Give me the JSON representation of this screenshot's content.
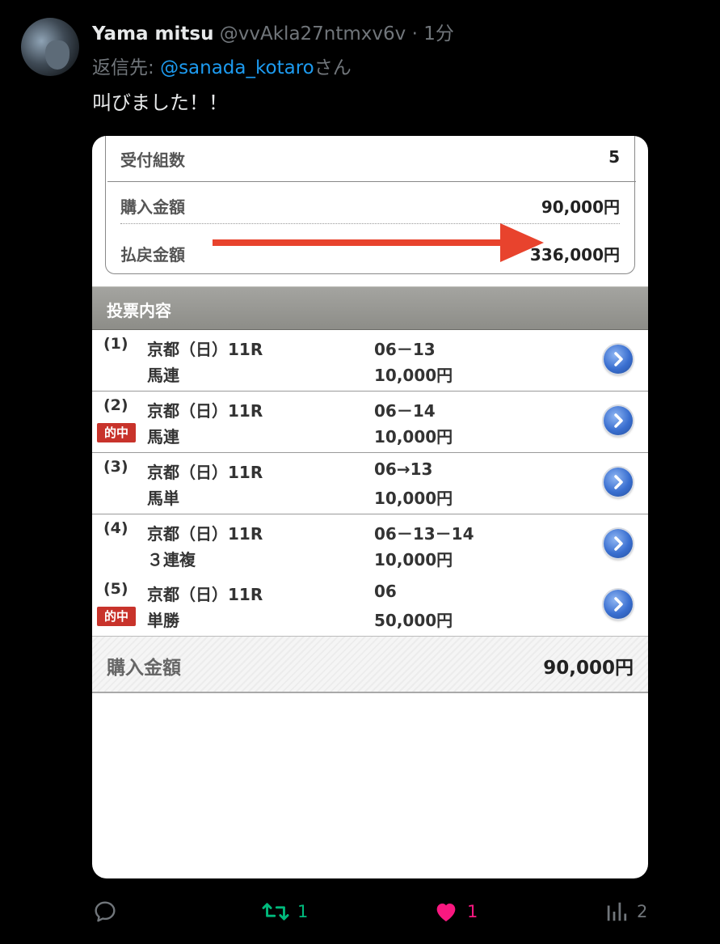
{
  "tweet": {
    "display_name": "Yama mitsu",
    "handle_time": "@vvAkla27ntmxv6v · 1分",
    "reply_prefix": "返信先: ",
    "reply_mention": "@sanada_kotaro",
    "reply_suffix": "さん",
    "text": "叫びました！！"
  },
  "ticket": {
    "summary": [
      {
        "label": "受付組数",
        "value": "5"
      },
      {
        "label": "購入金額",
        "value": "90,000円"
      },
      {
        "label": "払戻金額",
        "value": "336,000円"
      }
    ],
    "section_title": "投票内容",
    "bets": [
      {
        "num": "(1)",
        "hit": "",
        "race": "京都（日）11R",
        "type": "馬連",
        "combo": "06－13",
        "amount": "10,000円"
      },
      {
        "num": "(2)",
        "hit": "的中",
        "race": "京都（日）11R",
        "type": "馬連",
        "combo": "06－14",
        "amount": "10,000円"
      },
      {
        "num": "(3)",
        "hit": "",
        "race": "京都（日）11R",
        "type": "馬単",
        "combo": "06→13",
        "amount": "10,000円"
      },
      {
        "num": "(4)",
        "hit": "",
        "race": "京都（日）11R",
        "type": "３連複",
        "combo": "06－13－14",
        "amount": "10,000円"
      },
      {
        "num": "(5)",
        "hit": "的中",
        "race": "京都（日）11R",
        "type": "単勝",
        "combo": "06",
        "amount": "50,000円"
      }
    ],
    "total_label": "購入金額",
    "total_value": "90,000円",
    "arrow_color": "#e8432d",
    "hit_badge_color": "#c8332b"
  },
  "actions": {
    "reply_count": "",
    "retweet_count": "1",
    "like_count": "1",
    "view_count": "2",
    "retweet_color": "#00ba7c",
    "like_color": "#f91880",
    "neutral_color": "#71767b"
  }
}
